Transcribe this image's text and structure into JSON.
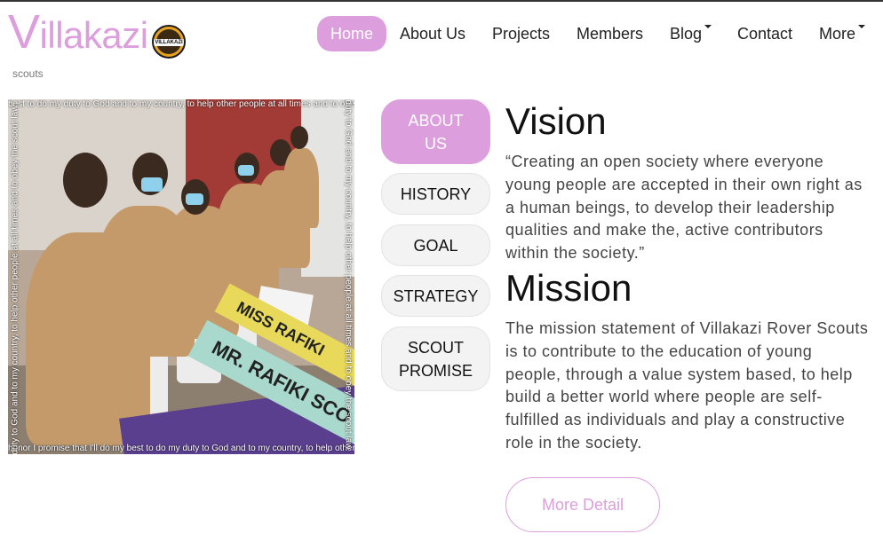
{
  "brand": {
    "logo_first_letter": "V",
    "logo_rest": "illakazi",
    "badge_text": "VILLAKAZI",
    "tagline": "scouts",
    "accent_color": "#dd9edd"
  },
  "nav": {
    "items": [
      {
        "label": "Home",
        "active": true
      },
      {
        "label": "About Us"
      },
      {
        "label": "Projects"
      },
      {
        "label": "Members"
      },
      {
        "label": "Blog",
        "dropdown": true
      },
      {
        "label": "Contact"
      },
      {
        "label": "More",
        "dropdown": true
      }
    ]
  },
  "photo": {
    "caption_top": "best to do my duty to God and to my country, to help other people at all times and to obey the scout law.",
    "caption_bottom": "honor I promise that I'll do my best to do my duty to God and to my country, to help other people at all times",
    "caption_left": "duty to God and to my country, to help other people at all times and to obey the scout law",
    "caption_right": "duty to God and to my country, to help other people at all times and to obey the scout law",
    "sash1_text": "MISS RAFIKI",
    "sash2_text": "MR. RAFIKI SCO"
  },
  "tabs": [
    {
      "label": "ABOUT US",
      "active": true
    },
    {
      "label": "HISTORY"
    },
    {
      "label": "GOAL"
    },
    {
      "label": "STRATEGY"
    },
    {
      "label": "SCOUT PROMISE"
    }
  ],
  "vision": {
    "heading": "Vision",
    "text": "“Creating an open society where everyone young people are accepted in their own right as a human beings, to develop their leadership qualities and make the, active contributors within the society.”"
  },
  "mission": {
    "heading": "Mission",
    "text": "The mission statement of Villakazi Rover Scouts is to contribute to the education of young people, through a value system based, to help build a better world where people are self-fulfilled as individuals and play a constructive role in the society."
  },
  "cta": {
    "label": "More Detail"
  }
}
